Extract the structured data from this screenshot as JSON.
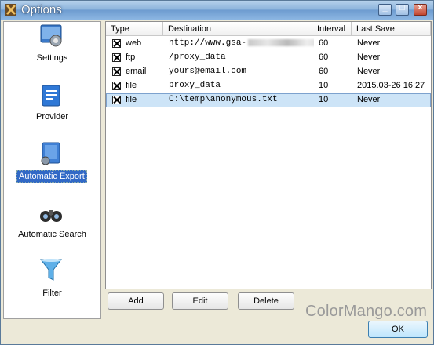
{
  "window": {
    "title": "Options"
  },
  "sidebar": {
    "items": [
      {
        "label": "Settings",
        "icon": "settings-icon",
        "selected": false
      },
      {
        "label": "Provider",
        "icon": "provider-icon",
        "selected": false
      },
      {
        "label": "Automatic Export",
        "icon": "automatic-export-icon",
        "selected": true
      },
      {
        "label": "Automatic Search",
        "icon": "binoculars-icon",
        "selected": false
      },
      {
        "label": "Filter",
        "icon": "filter-icon",
        "selected": false
      }
    ]
  },
  "table": {
    "columns": [
      "Type",
      "Destination",
      "Interval",
      "Last Save"
    ],
    "rows": [
      {
        "checked": true,
        "type": "web",
        "destination": "http://www.gsa-",
        "interval": "60",
        "last_save": "Never"
      },
      {
        "checked": true,
        "type": "ftp",
        "destination": "/proxy_data",
        "interval": "60",
        "last_save": "Never"
      },
      {
        "checked": true,
        "type": "email",
        "destination": "yours@email.com",
        "interval": "60",
        "last_save": "Never"
      },
      {
        "checked": true,
        "type": "file",
        "destination": "proxy_data",
        "interval": "10",
        "last_save": "2015.03-26 16:27"
      },
      {
        "checked": true,
        "type": "file",
        "destination": "C:\\temp\\anonymous.txt",
        "interval": "10",
        "last_save": "Never",
        "selected": true
      }
    ]
  },
  "buttons": {
    "add": "Add",
    "edit": "Edit",
    "delete": "Delete",
    "ok": "OK"
  },
  "watermark": "ColorMango.com",
  "colors": {
    "selection": "#3169c6",
    "row_selected": "#cde4f7",
    "titlebar": "#8db4dc"
  }
}
